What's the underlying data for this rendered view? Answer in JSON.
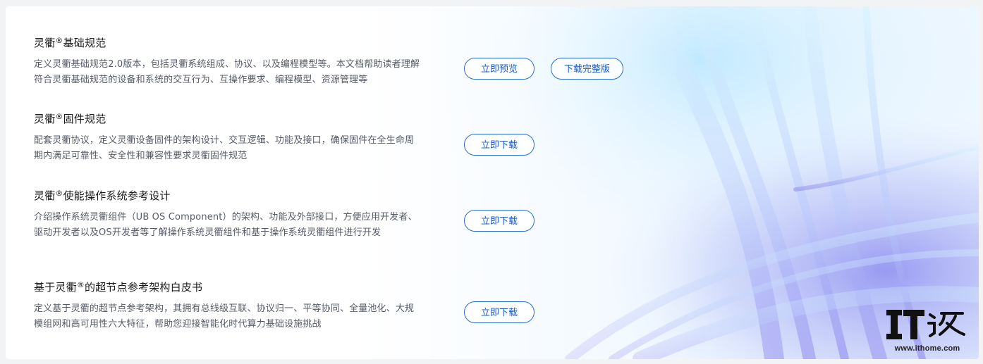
{
  "items": [
    {
      "title_prefix": "灵衢",
      "title_mark": "®",
      "title_suffix": "基础规范",
      "desc": "定义灵衢基础规范2.0版本，包括灵衢系统组成、协议、以及编程模型等。本文档帮助读者理解符合灵衢基础规范的设备和系统的交互行为、互操作要求、编程模型、资源管理等",
      "buttons": [
        "立即预览",
        "下载完整版"
      ]
    },
    {
      "title_prefix": "灵衢",
      "title_mark": "®",
      "title_suffix": "固件规范",
      "desc": "配套灵衢协议，定义灵衢设备固件的架构设计、交互逻辑、功能及接口，确保固件在全生命周期内满足可靠性、安全性和兼容性要求灵衢固件规范",
      "buttons": [
        "立即下载"
      ]
    },
    {
      "title_prefix": "灵衢",
      "title_mark": "®",
      "title_suffix": "使能操作系统参考设计",
      "desc": "介绍操作系统灵衢组件（UB OS Component）的架构、功能及外部接口，方便应用开发者、驱动开发者以及OS开发者等了解操作系统灵衢组件和基于操作系统灵衢组件进行开发",
      "buttons": [
        "立即下载"
      ]
    },
    {
      "title_prefix": "基于灵衢",
      "title_mark": "®",
      "title_suffix": "的超节点参考架构白皮书",
      "desc": "定义基于灵衢的超节点参考架构，其拥有总线级互联、协议归一、平等协同、全量池化、大规模组网和高可用性六大特征，帮助您迎接智能化时代算力基础设施挑战",
      "buttons": [
        "立即下载"
      ]
    }
  ],
  "watermark": {
    "logo_text": "IT之家",
    "url": "www.ithome.com"
  },
  "colors": {
    "accent": "#2a6cd3",
    "title": "#1a1a1a",
    "desc": "#555b66"
  }
}
